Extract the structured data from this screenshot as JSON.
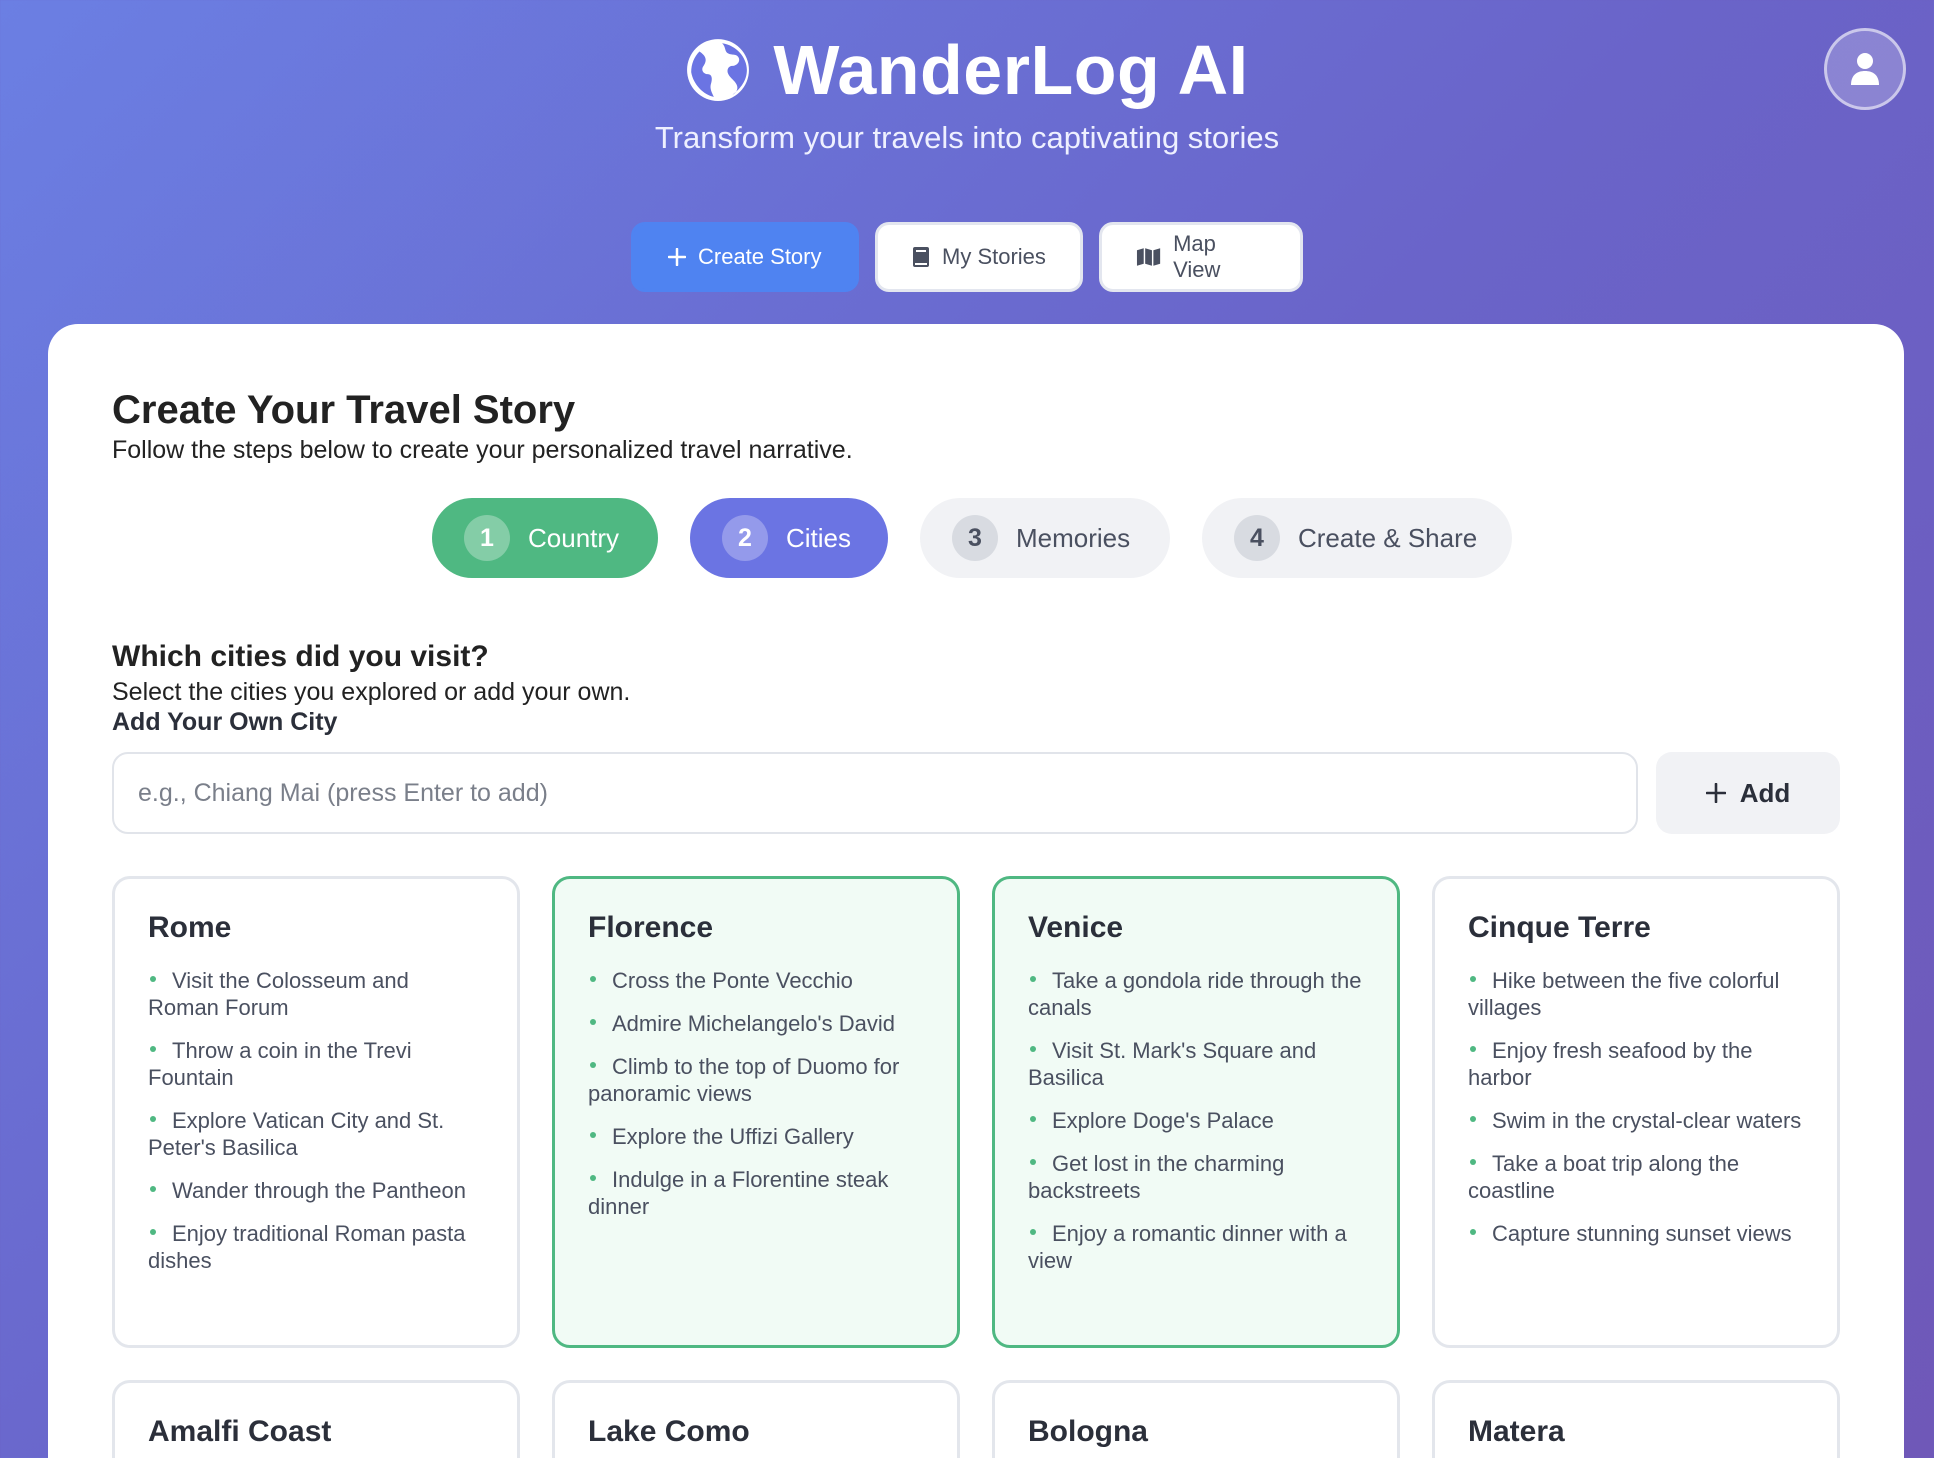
{
  "app": {
    "title": "WanderLog AI",
    "tagline": "Transform your travels into captivating stories",
    "user_icon": "user-icon"
  },
  "nav": {
    "items": [
      {
        "label": "Create Story",
        "icon": "plus-icon",
        "active": true
      },
      {
        "label": "My Stories",
        "icon": "book-icon",
        "active": false
      },
      {
        "label": "Map View",
        "icon": "map-icon",
        "active": false
      }
    ]
  },
  "page": {
    "title": "Create Your Travel Story",
    "subtitle": "Follow the steps below to create your personalized travel narrative."
  },
  "steps": [
    {
      "num": "1",
      "label": "Country",
      "state": "done"
    },
    {
      "num": "2",
      "label": "Cities",
      "state": "current"
    },
    {
      "num": "3",
      "label": "Memories",
      "state": "pending"
    },
    {
      "num": "4",
      "label": "Create & Share",
      "state": "pending"
    }
  ],
  "cities_section": {
    "question": "Which cities did you visit?",
    "hint": "Select the cities you explored or add your own.",
    "add_label": "Add Your Own City",
    "input_placeholder": "e.g., Chiang Mai (press Enter to add)",
    "input_value": "",
    "add_button": "Add"
  },
  "cities": [
    {
      "name": "Rome",
      "selected": false,
      "activities": [
        "Visit the Colosseum and Roman Forum",
        "Throw a coin in the Trevi Fountain",
        "Explore Vatican City and St. Peter's Basilica",
        "Wander through the Pantheon",
        "Enjoy traditional Roman pasta dishes"
      ]
    },
    {
      "name": "Florence",
      "selected": true,
      "activities": [
        "Cross the Ponte Vecchio",
        "Admire Michelangelo's David",
        "Climb to the top of Duomo for panoramic views",
        "Explore the Uffizi Gallery",
        "Indulge in a Florentine steak dinner"
      ]
    },
    {
      "name": "Venice",
      "selected": true,
      "activities": [
        "Take a gondola ride through the canals",
        "Visit St. Mark's Square and Basilica",
        "Explore Doge's Palace",
        "Get lost in the charming backstreets",
        "Enjoy a romantic dinner with a view"
      ]
    },
    {
      "name": "Cinque Terre",
      "selected": false,
      "activities": [
        "Hike between the five colorful villages",
        "Enjoy fresh seafood by the harbor",
        "Swim in the crystal-clear waters",
        "Take a boat trip along the coastline",
        "Capture stunning sunset views"
      ]
    },
    {
      "name": "Amalfi Coast",
      "selected": false,
      "activities": []
    },
    {
      "name": "Lake Como",
      "selected": false,
      "activities": []
    },
    {
      "name": "Bologna",
      "selected": false,
      "activities": []
    },
    {
      "name": "Matera",
      "selected": false,
      "activities": []
    }
  ],
  "colors": {
    "accent_blue": "#4f83f1",
    "step_done": "#4fb882",
    "step_current": "#6b74e3",
    "selected_border": "#4fb882"
  }
}
